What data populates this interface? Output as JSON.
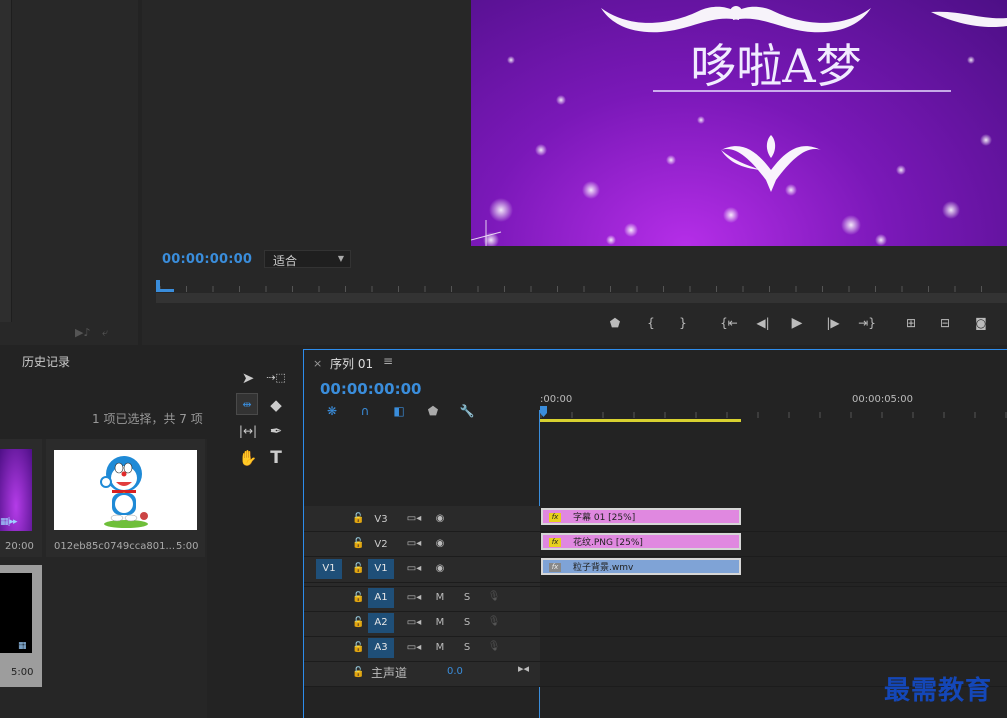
{
  "program": {
    "timecode": "00:00:00:00",
    "fit_value": "适合",
    "video_title": "哆啦A梦"
  },
  "history": {
    "tab_label": "历史记录",
    "selection_count": "1 项已选择，共 7 项",
    "items": [
      {
        "duration": "20:00"
      },
      {
        "label": "012eb85c0749cca801...",
        "duration": "5:00"
      },
      {
        "duration": "5:00"
      }
    ]
  },
  "timeline": {
    "tab_title": "序列 01",
    "timecode": "00:00:00:00",
    "ruler": {
      "start": ":00:00",
      "mark": "00:00:05:00"
    },
    "video_tracks": [
      {
        "label": "V3",
        "clip": "字幕 01 [25%]"
      },
      {
        "label": "V2",
        "clip": "花纹.PNG [25%]"
      },
      {
        "label": "V1",
        "source": "V1",
        "clip": "粒子背景.wmv"
      }
    ],
    "audio_tracks": [
      {
        "label": "A1",
        "m": "M",
        "s": "S"
      },
      {
        "label": "A2",
        "m": "M",
        "s": "S"
      },
      {
        "label": "A3",
        "m": "M",
        "s": "S"
      }
    ],
    "master": {
      "label": "主声道",
      "value": "0.0"
    },
    "clip_colors": {
      "video": "#e088e0",
      "background": "#7fa3d6"
    }
  },
  "watermark": "最需教育",
  "colors": {
    "accent": "#3a8ddb",
    "panel": "#232323"
  }
}
